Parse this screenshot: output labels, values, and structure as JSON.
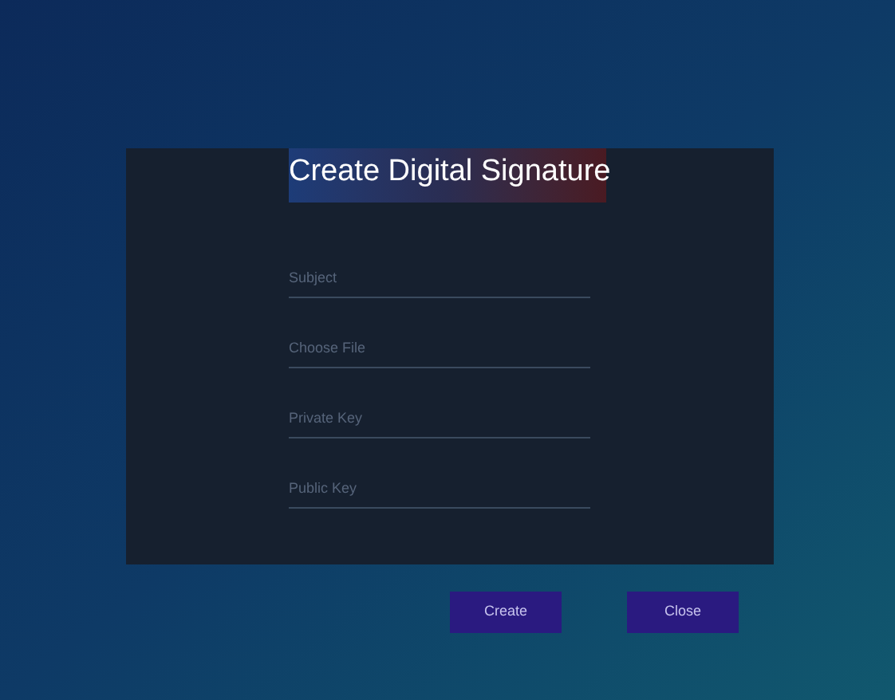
{
  "dialog": {
    "title": "Create Digital Signature"
  },
  "fields": [
    {
      "placeholder": "Subject"
    },
    {
      "placeholder": "Choose File"
    },
    {
      "placeholder": "Private Key"
    },
    {
      "placeholder": "Public Key"
    }
  ],
  "buttons": [
    "Create",
    "Close"
  ]
}
